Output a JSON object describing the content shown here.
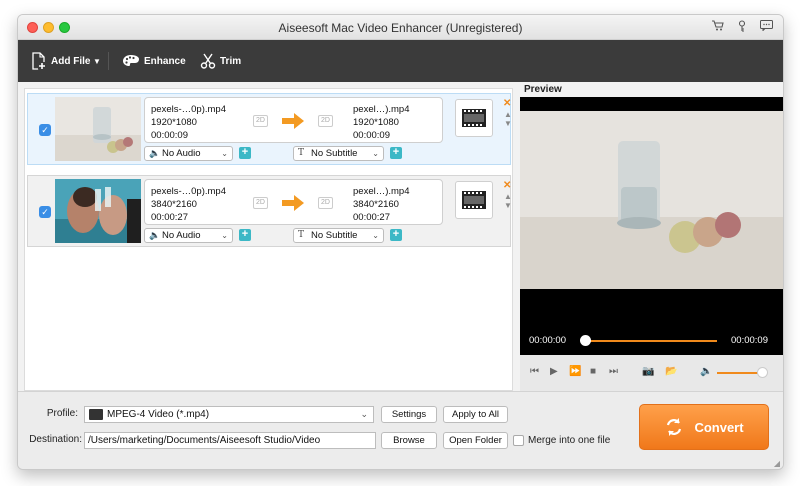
{
  "window": {
    "title": "Aiseesoft Mac Video Enhancer (Unregistered)",
    "icons": [
      "cart-icon",
      "key-icon",
      "chat-icon"
    ]
  },
  "toolbar": {
    "add_file": "Add File",
    "enhance": "Enhance",
    "trim": "Trim"
  },
  "files": [
    {
      "selected": true,
      "src_name": "pexels-…0p).mp4",
      "src_res": "1920*1080",
      "src_dur": "00:00:09",
      "dst_name": "pexel…).mp4",
      "dst_res": "1920*1080",
      "dst_dur": "00:00:09",
      "badge": "2D",
      "audio": "No Audio",
      "subtitle": "No Subtitle"
    },
    {
      "selected": true,
      "src_name": "pexels-…0p).mp4",
      "src_res": "3840*2160",
      "src_dur": "00:00:27",
      "dst_name": "pexel…).mp4",
      "dst_res": "3840*2160",
      "dst_dur": "00:00:27",
      "badge": "2D",
      "audio": "No Audio",
      "subtitle": "No Subtitle"
    }
  ],
  "preview": {
    "label": "Preview",
    "time_current": "00:00:00",
    "time_total": "00:00:09",
    "progress": 0.0,
    "volume": 0.9
  },
  "bottom": {
    "profile_label": "Profile:",
    "profile_value": "MPEG-4 Video (*.mp4)",
    "settings": "Settings",
    "apply_all": "Apply to All",
    "destination_label": "Destination:",
    "destination_value": "/Users/marketing/Documents/Aiseesoft Studio/Video",
    "browse": "Browse",
    "open_folder": "Open Folder",
    "merge_label": "Merge into one file",
    "merge_checked": false,
    "convert": "Convert"
  },
  "colors": {
    "accent_orange": "#f08a1c",
    "check_blue": "#3a8ee6",
    "plus_teal": "#3cb8c6",
    "toolbar_dark": "#3b3b3b"
  }
}
